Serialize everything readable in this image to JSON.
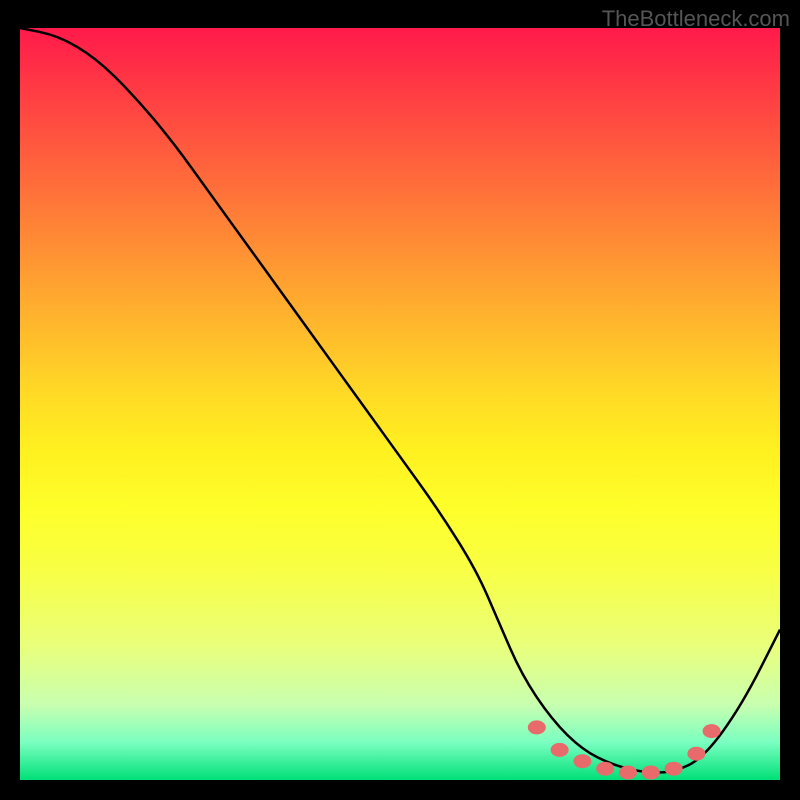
{
  "watermark": "TheBottleneck.com",
  "chart_data": {
    "type": "line",
    "title": "",
    "xlabel": "",
    "ylabel": "",
    "xlim": [
      0,
      100
    ],
    "ylim": [
      0,
      100
    ],
    "series": [
      {
        "name": "bottleneck-curve",
        "x": [
          0,
          5,
          10,
          15,
          20,
          25,
          30,
          35,
          40,
          45,
          50,
          55,
          60,
          63,
          66,
          70,
          74,
          78,
          82,
          86,
          90,
          95,
          100
        ],
        "values": [
          100,
          99,
          96,
          91,
          85,
          78,
          71,
          64,
          57,
          50,
          43,
          36,
          28,
          21,
          14,
          8,
          4,
          2,
          1,
          1,
          3,
          10,
          20
        ]
      },
      {
        "name": "optimal-markers",
        "x": [
          68,
          71,
          74,
          77,
          80,
          83,
          86,
          89,
          91
        ],
        "values": [
          7,
          4,
          2.5,
          1.5,
          1,
          1,
          1.5,
          3.5,
          6.5
        ]
      }
    ]
  }
}
